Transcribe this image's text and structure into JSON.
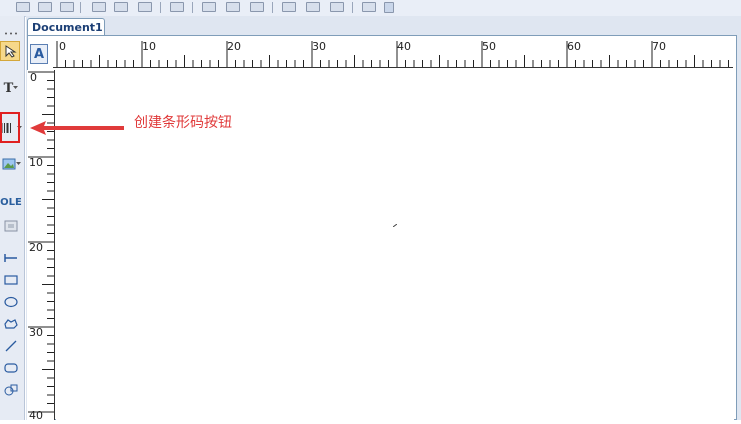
{
  "document_tab": {
    "title": "Document1"
  },
  "toolbox": {
    "text_tool_label": "T",
    "ole_label": "OLE"
  },
  "corner_button": {
    "label": "A"
  },
  "ruler_horizontal": {
    "labels": [
      "0",
      "10",
      "20",
      "30",
      "40",
      "50",
      "60",
      "70"
    ]
  },
  "ruler_vertical": {
    "labels": [
      "0",
      "10",
      "20",
      "30",
      "40"
    ]
  },
  "annotation": {
    "label": "创建条形码按钮"
  },
  "colors": {
    "highlight": "#e02020",
    "annotation": "#e03a3a",
    "tab_text": "#1c3f75"
  }
}
